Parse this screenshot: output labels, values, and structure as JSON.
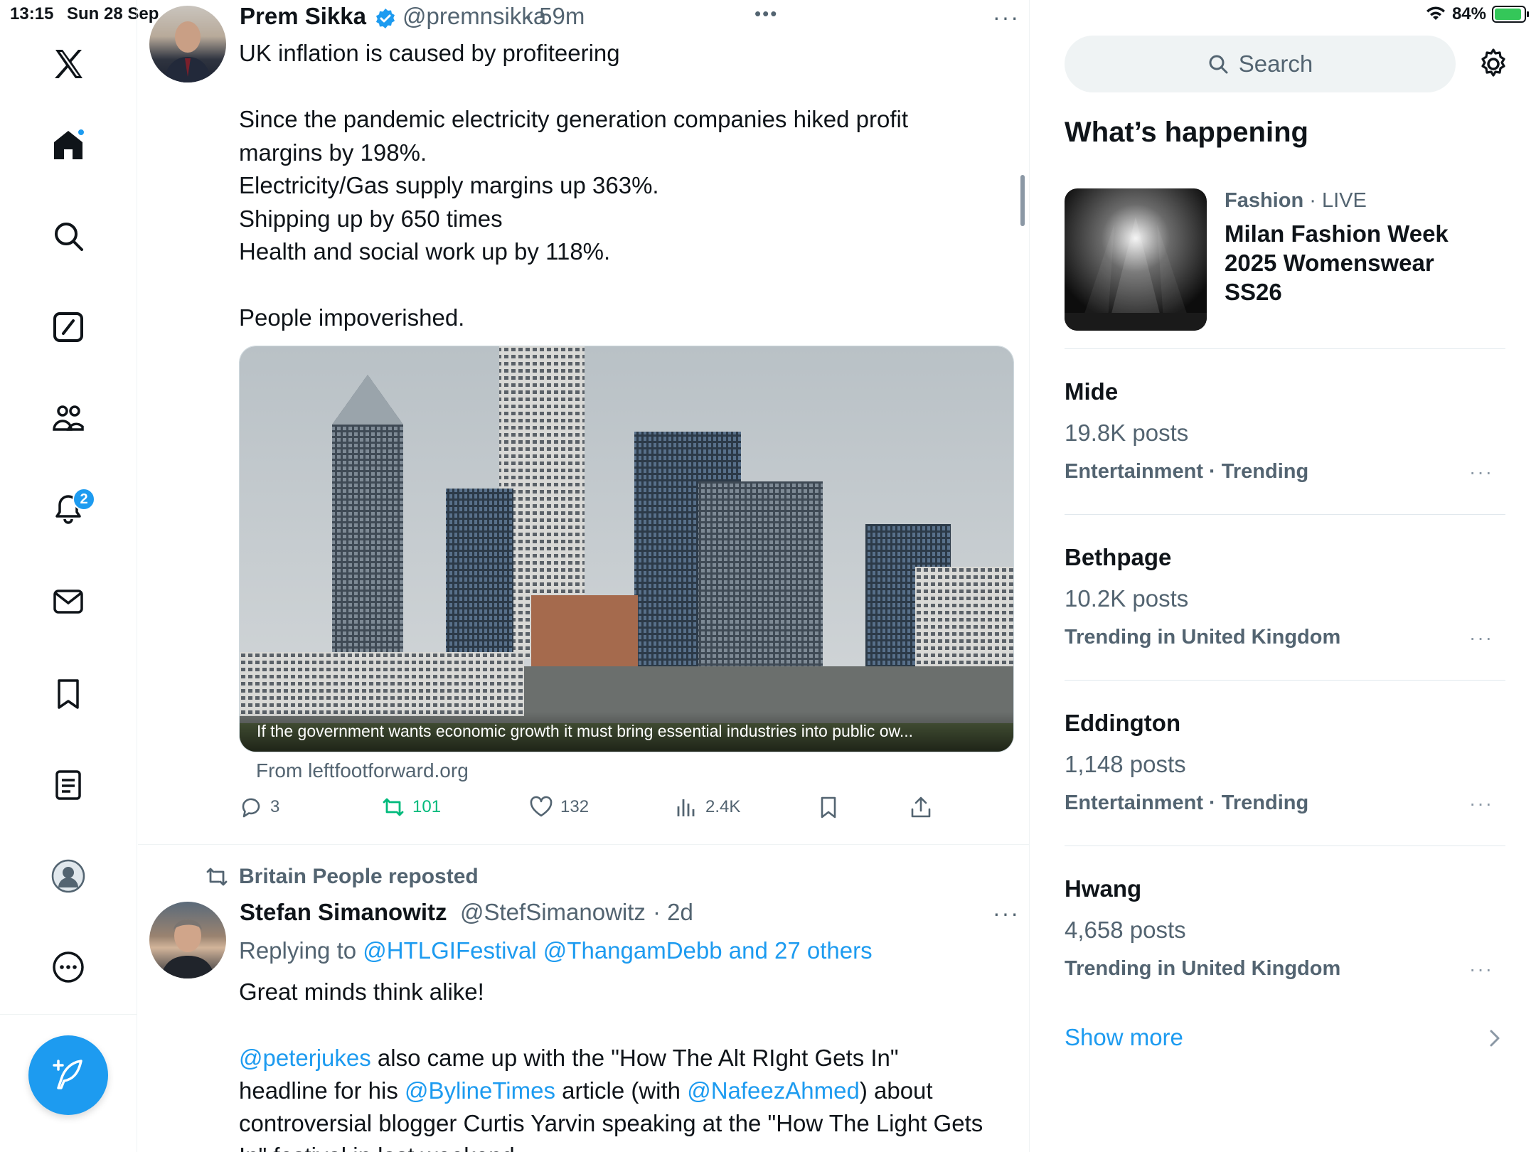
{
  "status_bar": {
    "time": "13:15",
    "date": "Sun 28 Sep",
    "battery": "84%",
    "battery_level": 0.84
  },
  "nav": {
    "notifications_badge": "2",
    "items": [
      "X logo",
      "Home",
      "Explore",
      "Grok",
      "Communities",
      "Notifications",
      "Messages",
      "Bookmarks",
      "Lists",
      "Profile",
      "More"
    ]
  },
  "tweet1": {
    "name": "Prem Sikka",
    "handle": "@premnsikka",
    "time": "· 59m",
    "text": "UK inflation is caused by profiteering\n\nSince the pandemic electricity generation companies hiked profit\nmargins by 198%.\nElectricity/Gas supply margins up 363%.\nShipping up by 650 times\nHealth and social work up by 118%.\n\nPeople impoverished.",
    "media_caption": "If the government wants economic growth it must bring essential industries into public ow...",
    "from_link": "From leftfootforward.org",
    "replies": "3",
    "reposts": "101",
    "likes": "132",
    "views": "2.4K",
    "top_dots": "•••",
    "more_dots": "···"
  },
  "tweet2": {
    "repost_by": "Britain People reposted",
    "name": "Stefan Simanowitz",
    "handle": "@StefSimanowitz",
    "time": "· 2d",
    "more_dots": "···",
    "replying_prefix": "Replying to ",
    "replying_users": "@HTLGIFestival @ThangamDebb and 27 others",
    "line1": "Great minds think alike!",
    "mention1": "@peterjukes",
    "text_a": " also came up with the \"How The Alt RIght Gets In\"",
    "text_b": "headline for his ",
    "mention2": "@BylineTimes",
    "text_c": " article (with ",
    "mention3": "@NafeezAhmed",
    "text_d": ") about",
    "text_e": "controversial blogger Curtis Yarvin speaking at the \"How The Light Gets",
    "text_f": "In\" festival in last weekend"
  },
  "right": {
    "search_placeholder": "Search",
    "section_title": "What’s happening",
    "feature": {
      "category": "Fashion",
      "status": " · LIVE",
      "title": "Milan Fashion Week 2025 Womenswear SS26"
    },
    "trends": [
      {
        "name": "Mide",
        "posts": "19.8K posts",
        "context": "Entertainment · Trending"
      },
      {
        "name": "Bethpage",
        "posts": "10.2K posts",
        "context": "Trending in United Kingdom"
      },
      {
        "name": "Eddington",
        "posts": "1,148 posts",
        "context": "Entertainment · Trending"
      },
      {
        "name": "Hwang",
        "posts": "4,658 posts",
        "context": "Trending in United Kingdom"
      }
    ],
    "trend_more": "···",
    "show_more": "Show more"
  },
  "colors": {
    "accent": "#1d9bf0",
    "retweet": "#00ba7c",
    "muted": "#536471"
  }
}
